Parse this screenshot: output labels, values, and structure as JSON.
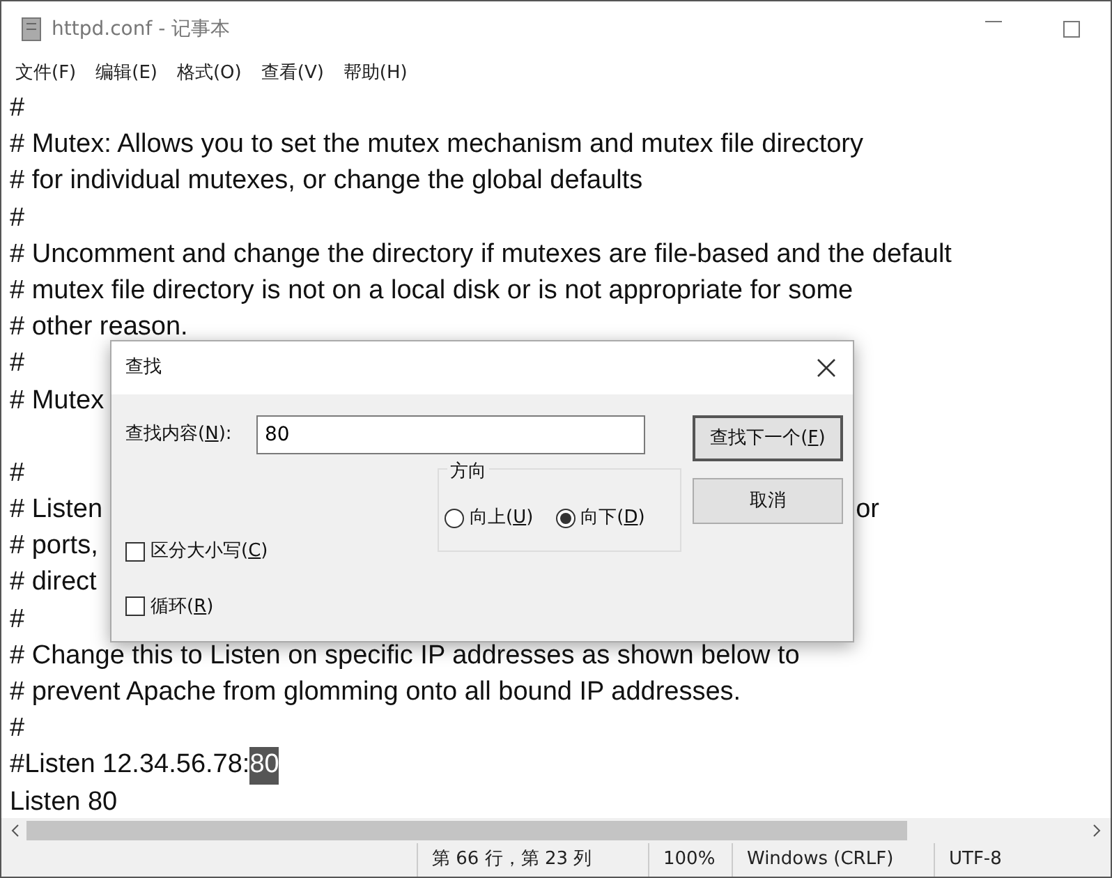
{
  "window": {
    "title": "httpd.conf - 记事本"
  },
  "menu": [
    "文件(F)",
    "编辑(E)",
    "格式(O)",
    "查看(V)",
    "帮助(H)"
  ],
  "lines": [
    {
      "text": "#"
    },
    {
      "text": "# Mutex: Allows you to set the mutex mechanism and mutex file directory"
    },
    {
      "text": "# for individual mutexes, or change the global defaults"
    },
    {
      "text": "#"
    },
    {
      "text": "# Uncomment and change the directory if mutexes are file-based and the default"
    },
    {
      "text": "# mutex file directory is not on a local disk or is not appropriate for some"
    },
    {
      "text": "# other reason."
    },
    {
      "text": "#"
    },
    {
      "text": "# Mutex"
    },
    {
      "text": "#",
      "blank_before": true
    },
    {
      "text": "# Listen",
      "tail": "or"
    },
    {
      "text": "# ports,"
    },
    {
      "text": "# direct"
    },
    {
      "text": "#"
    },
    {
      "text": "# Change this to Listen on specific IP addresses as shown below to"
    },
    {
      "text": "# prevent Apache from glomming onto all bound IP addresses."
    },
    {
      "text": "#"
    },
    {
      "text": "#Listen 12.34.56.78:",
      "selection": "80"
    },
    {
      "text": "Listen 80"
    }
  ],
  "status_bar": [
    "第 66 行，第 23 列",
    "100%",
    "Windows (CRLF)",
    "UTF-8"
  ],
  "dialog": {
    "title": "查找",
    "find_label": {
      "before": "查找内容(",
      "key": "N",
      "after": "):"
    },
    "find_value": "80",
    "buttons": [
      {
        "before": "查找下一个(",
        "key": "F",
        "after": ")",
        "default": true
      },
      {
        "before": "取消",
        "default": false
      }
    ],
    "options": [
      {
        "before": "区分大小写(",
        "key": "C",
        "after": ")",
        "checked": false
      },
      {
        "before": "循环(",
        "key": "R",
        "after": ")",
        "checked": false
      }
    ],
    "direction": {
      "title": "方向",
      "choices": [
        {
          "before": "向上(",
          "key": "U",
          "after": ")",
          "selected": false
        },
        {
          "before": "向下(",
          "key": "D",
          "after": ")",
          "selected": true
        }
      ]
    }
  }
}
